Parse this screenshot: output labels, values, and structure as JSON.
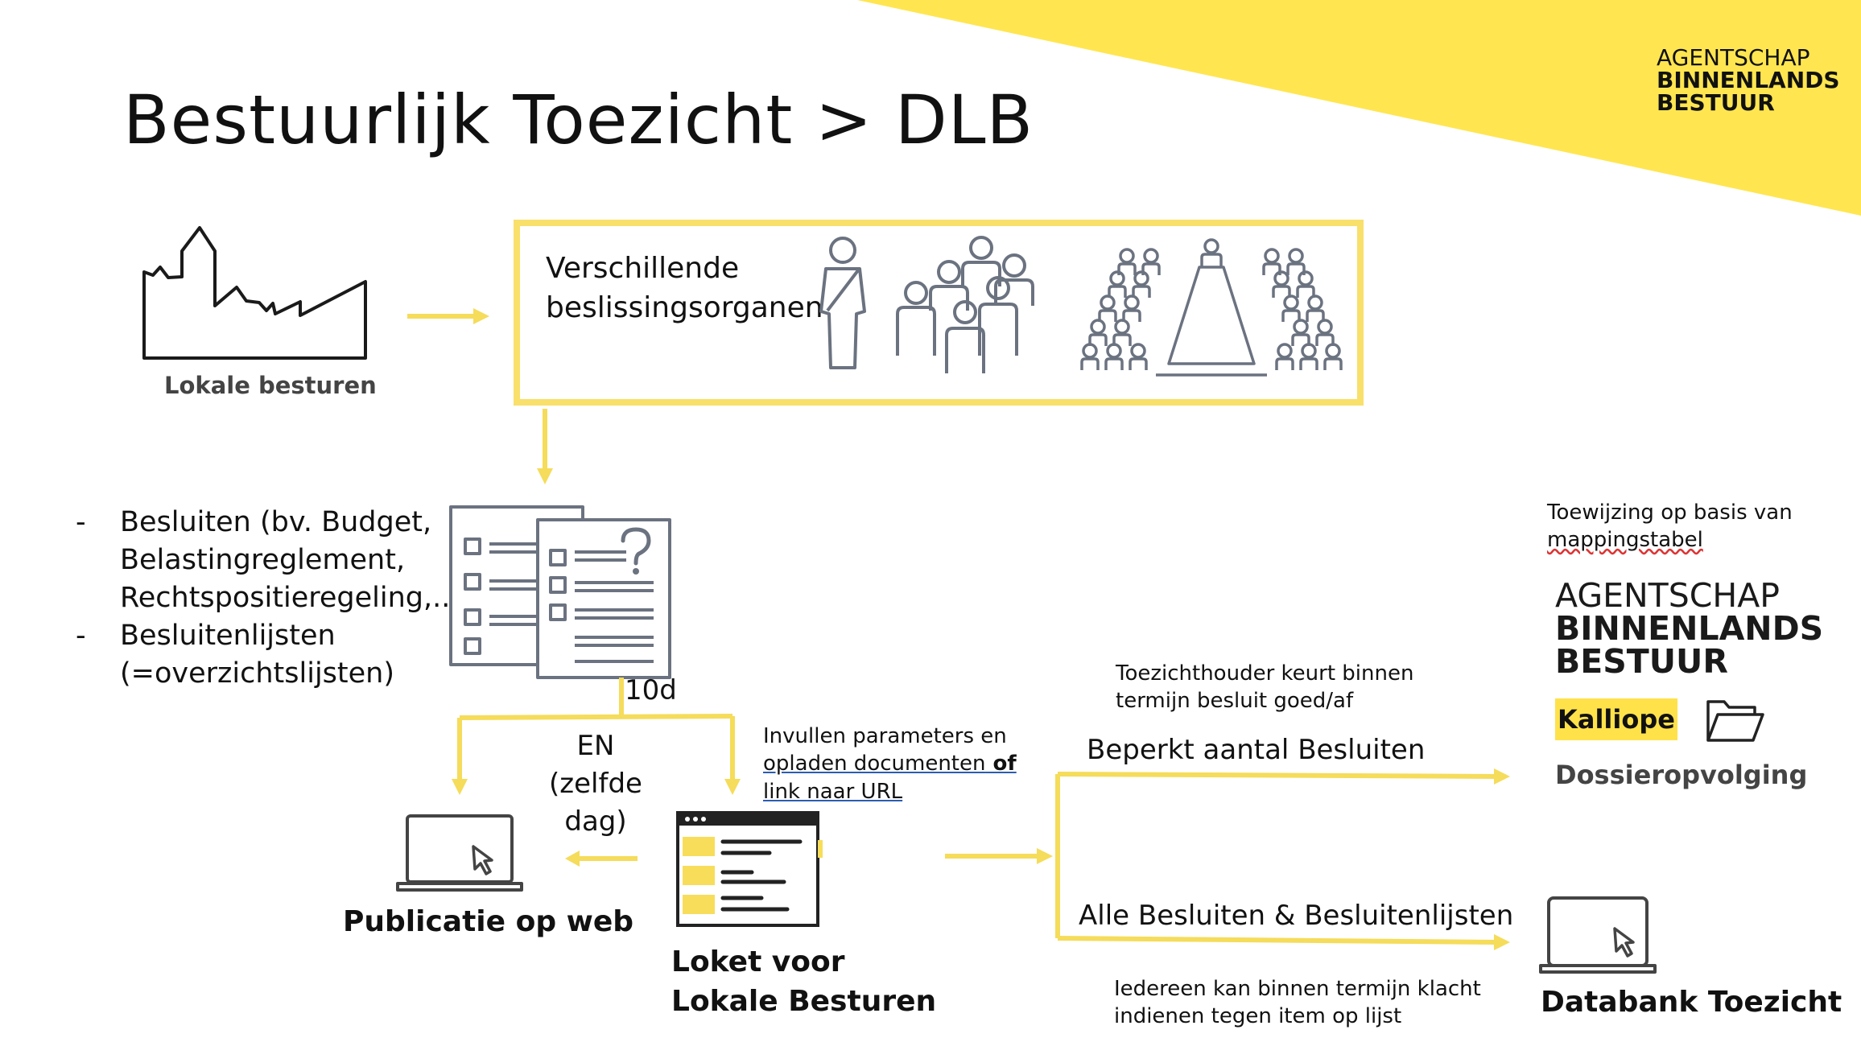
{
  "title": "Bestuurlijk Toezicht > DLB",
  "logo_top": [
    "AGENTSCHAP",
    "BINNENLANDS",
    "BESTUUR"
  ],
  "lokale_besturen": {
    "label": "Lokale besturen"
  },
  "organs_box": {
    "label_lines": [
      "Verschillende",
      "beslissingsorganen"
    ]
  },
  "decisions_list": [
    [
      "Besluiten (bv. Budget,",
      "Belastingreglement,",
      "Rechtspositieregeling,..."
    ],
    [
      "Besluitenlijsten",
      "(=overzichtslijsten)"
    ]
  ],
  "deadline_label": "10d",
  "en_label": [
    "EN",
    "(zelfde dag)"
  ],
  "publicatie": {
    "label": "Publicatie op web"
  },
  "loket": {
    "label_lines": [
      "Loket voor",
      "Lokale Besturen"
    ]
  },
  "invullen": {
    "line1": "Invullen parameters en",
    "line2_link": "opladen documenten",
    "line2_rest": " of",
    "line3_link": "link naar URL"
  },
  "toezichthouder_note": [
    "Toezichthouder keurt binnen",
    "termijn besluit goed/af"
  ],
  "beperkt_label": "Beperkt aantal Besluiten",
  "alle_label": "Alle Besluiten & Besluitenlijsten",
  "iedereen_note": [
    "Iedereen kan binnen termijn klacht",
    "indienen tegen item op lijst"
  ],
  "toewijzing_note": {
    "line1": "Toewijzing op basis van",
    "line2": "mappingstabel"
  },
  "logo_big": [
    "AGENTSCHAP",
    "BINNENLANDS",
    "BESTUUR"
  ],
  "kalliope": "Kalliope",
  "dossier": "Dossieropvolging",
  "databank": {
    "label": "Databank Toezicht"
  },
  "colors": {
    "accent_yellow": "#ffe650",
    "arrow_yellow": "#f5dc5a",
    "icon_gray": "#6b7280",
    "text": "#111111"
  }
}
